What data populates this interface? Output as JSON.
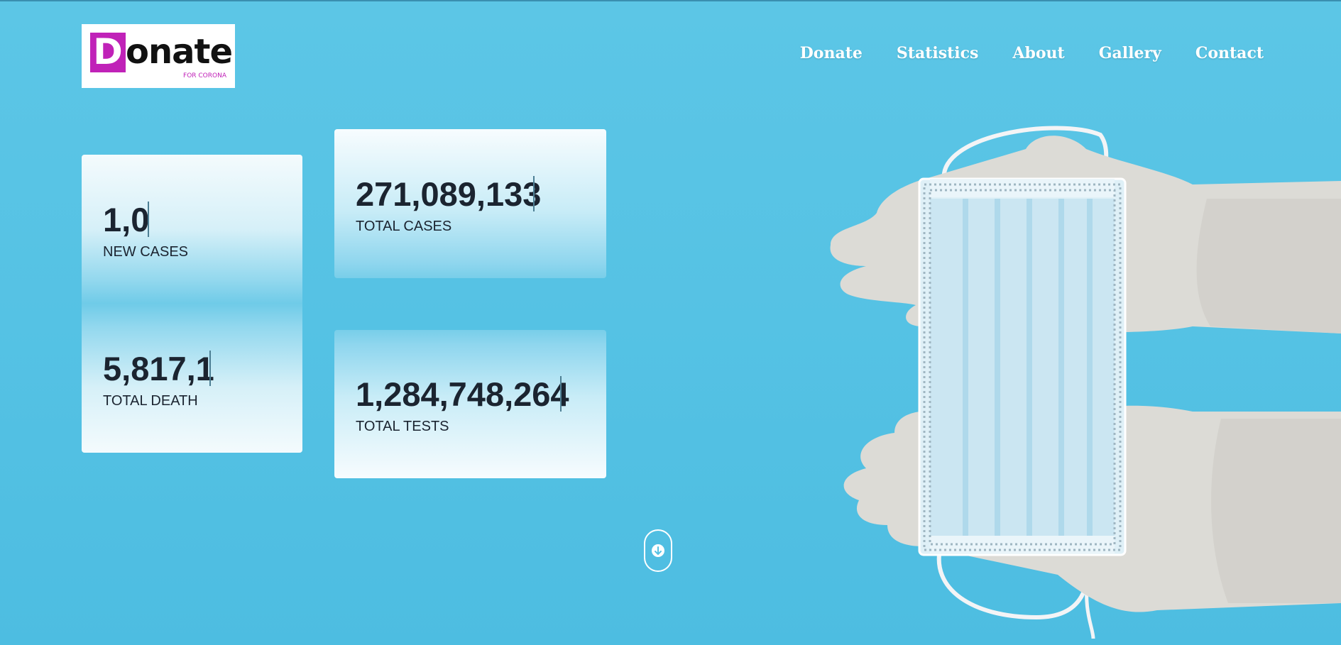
{
  "logo": {
    "letter": "D",
    "rest": "onate",
    "tagline": "FOR CORONA"
  },
  "nav": {
    "items": [
      "Donate",
      "Statistics",
      "About",
      "Gallery",
      "Contact"
    ]
  },
  "stats": {
    "new_cases": {
      "value": "1,0",
      "label": "NEW CASES"
    },
    "total_death": {
      "value": "5,817,1",
      "label": "TOTAL DEATH"
    },
    "total_cases": {
      "value": "271,089,133",
      "label": "TOTAL CASES"
    },
    "total_tests": {
      "value": "1,284,748,264",
      "label": "TOTAL TESTS"
    }
  },
  "icons": {
    "scroll": "arrow-down-icon"
  },
  "colors": {
    "background": "#55c2e4",
    "brand": "#c022b8",
    "text": "#1b2430"
  }
}
